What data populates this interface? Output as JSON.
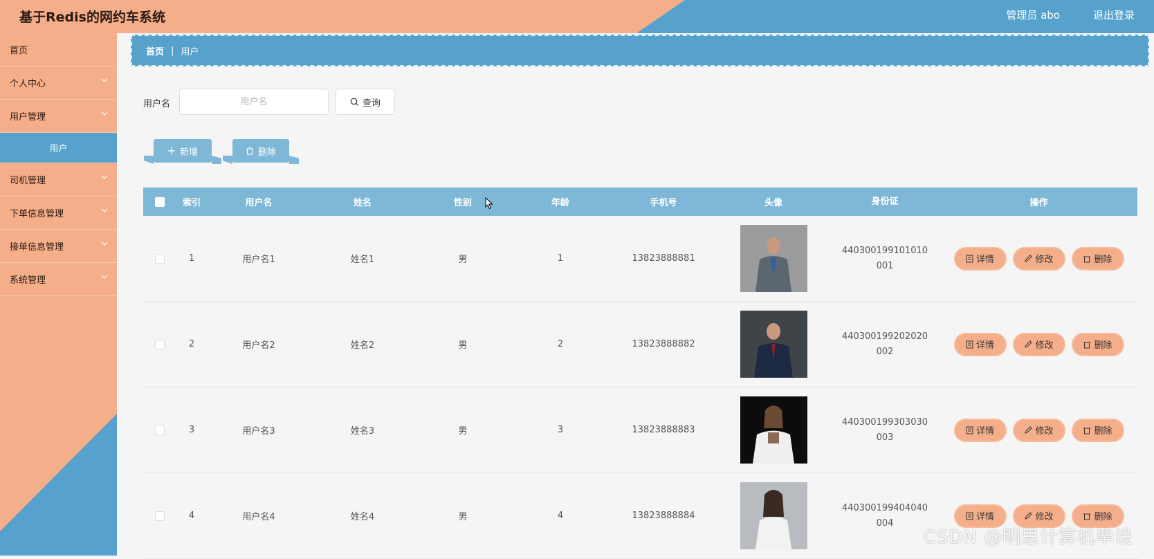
{
  "header": {
    "title": "基于Redis的网约车系统",
    "admin": "管理员 abo",
    "logout": "退出登录"
  },
  "sidebar": {
    "items": [
      {
        "label": "首页"
      },
      {
        "label": "个人中心"
      },
      {
        "label": "用户管理"
      },
      {
        "label": "用户"
      },
      {
        "label": "司机管理"
      },
      {
        "label": "下单信息管理"
      },
      {
        "label": "接单信息管理"
      },
      {
        "label": "系统管理"
      }
    ]
  },
  "breadcrumb": {
    "home": "首页",
    "separator": "|",
    "current": "用户"
  },
  "search": {
    "label": "用户名",
    "placeholder": "用户名",
    "button": "查询"
  },
  "actions": {
    "add": "新增",
    "delete": "删除"
  },
  "table": {
    "columns": [
      "索引",
      "用户名",
      "姓名",
      "性别",
      "年龄",
      "手机号",
      "头像",
      "身份证",
      "操作"
    ],
    "rows": [
      {
        "index": "1",
        "username": "用户名1",
        "name": "姓名1",
        "sex": "男",
        "age": "1",
        "phone": "13823888881",
        "id_line1": "440300199101010",
        "id_line2": "001",
        "detail": "详情",
        "edit": "修改",
        "del": "删除"
      },
      {
        "index": "2",
        "username": "用户名2",
        "name": "姓名2",
        "sex": "男",
        "age": "2",
        "phone": "13823888882",
        "id_line1": "440300199202020",
        "id_line2": "002",
        "detail": "详情",
        "edit": "修改",
        "del": "删除"
      },
      {
        "index": "3",
        "username": "用户名3",
        "name": "姓名3",
        "sex": "男",
        "age": "3",
        "phone": "13823888883",
        "id_line1": "440300199303030",
        "id_line2": "003",
        "detail": "详情",
        "edit": "修改",
        "del": "删除"
      },
      {
        "index": "4",
        "username": "用户名4",
        "name": "姓名4",
        "sex": "男",
        "age": "4",
        "phone": "13823888884",
        "id_line1": "440300199404040",
        "id_line2": "004",
        "detail": "详情",
        "edit": "修改",
        "del": "删除"
      }
    ]
  },
  "watermark": "CSDN @明思计算机毕设",
  "colors": {
    "salmon": "#f5ae8a",
    "blue": "#56a2cc",
    "table_header": "#7fb8d6"
  }
}
